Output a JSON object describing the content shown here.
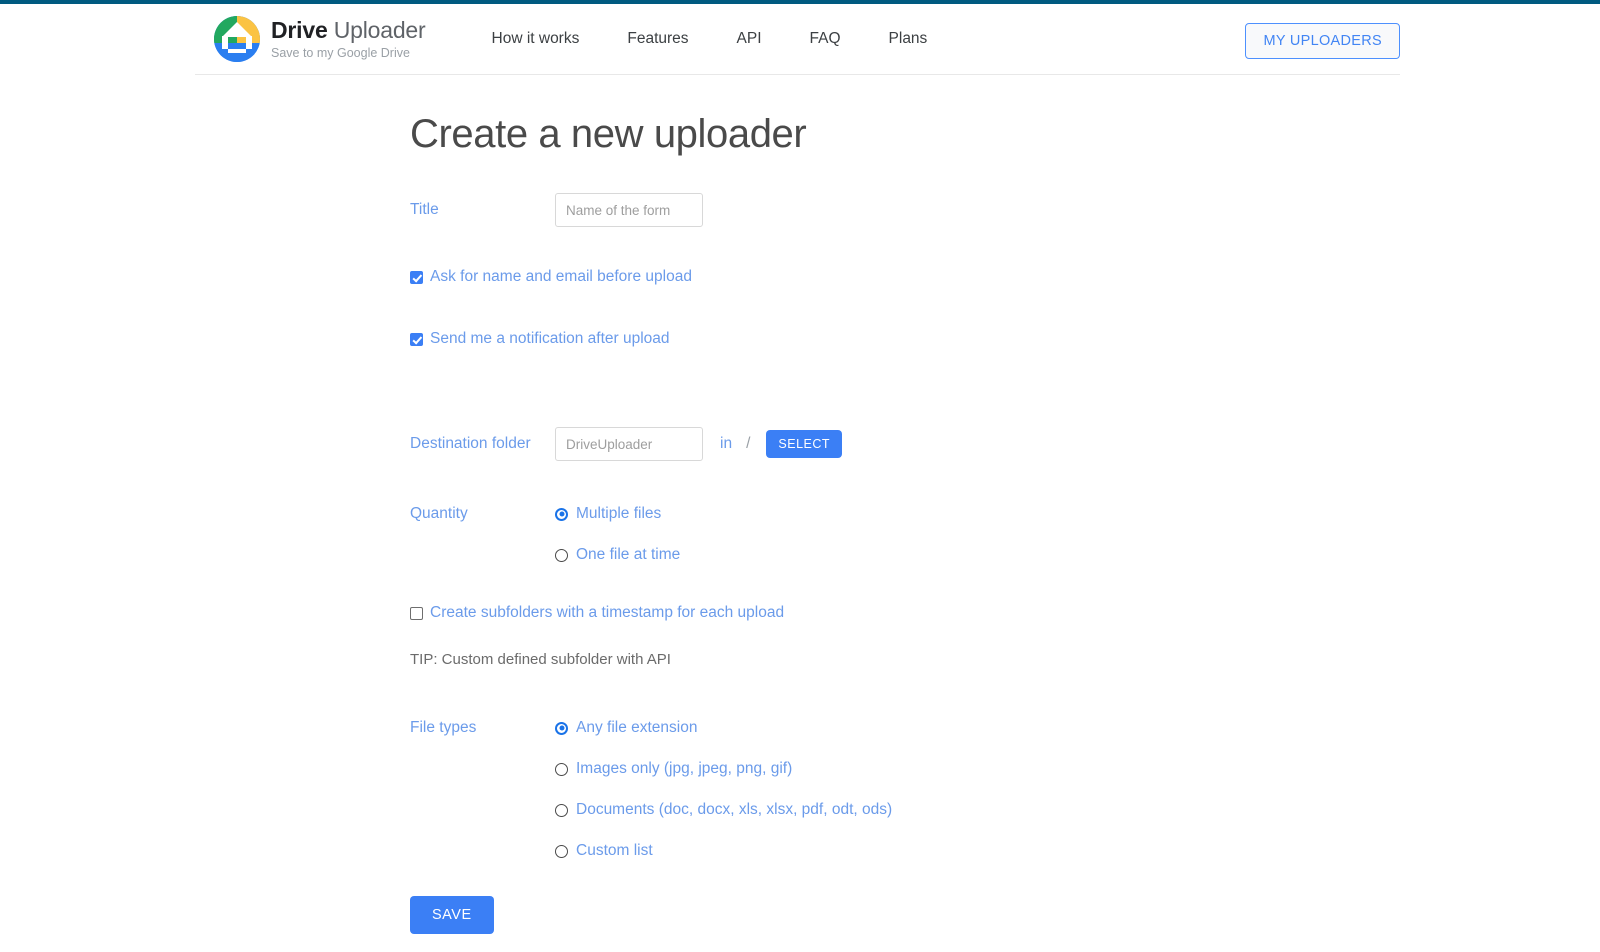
{
  "brand": {
    "title_bold": "Drive",
    "title_light": "Uploader",
    "tagline": "Save to my Google Drive",
    "logo_icon": "drive-uploader-logo-icon"
  },
  "nav": {
    "items": [
      {
        "label": "How it works"
      },
      {
        "label": "Features"
      },
      {
        "label": "API"
      },
      {
        "label": "FAQ"
      },
      {
        "label": "Plans"
      }
    ],
    "my_uploaders_label": "MY UPLOADERS"
  },
  "page": {
    "title": "Create a new uploader"
  },
  "form": {
    "title_field": {
      "label": "Title",
      "placeholder": "Name of the form",
      "value": ""
    },
    "ask_name_email": {
      "label": "Ask for name and email before upload",
      "checked": true
    },
    "notify_after_upload": {
      "label": "Send me a notification after upload",
      "checked": true
    },
    "destination": {
      "label": "Destination folder",
      "placeholder": "DriveUploader",
      "value": "",
      "in_word": "in",
      "path": "/",
      "select_label": "SELECT"
    },
    "quantity": {
      "label": "Quantity",
      "options": [
        {
          "label": "Multiple files",
          "selected": true
        },
        {
          "label": "One file at time",
          "selected": false
        }
      ]
    },
    "subfolders": {
      "label": "Create subfolders with a timestamp for each upload",
      "checked": false
    },
    "tip": "TIP: Custom defined subfolder with API",
    "file_types": {
      "label": "File types",
      "options": [
        {
          "label": "Any file extension",
          "selected": true
        },
        {
          "label": "Images only (jpg, jpeg, png, gif)",
          "selected": false
        },
        {
          "label": "Documents (doc, docx, xls, xlsx, pdf, odt, ods)",
          "selected": false
        },
        {
          "label": "Custom list",
          "selected": false
        }
      ]
    },
    "save_label": "SAVE"
  },
  "colors": {
    "accent_blue": "#3b7ff5",
    "label_blue": "#6b9bea",
    "top_bar": "#005a80"
  }
}
